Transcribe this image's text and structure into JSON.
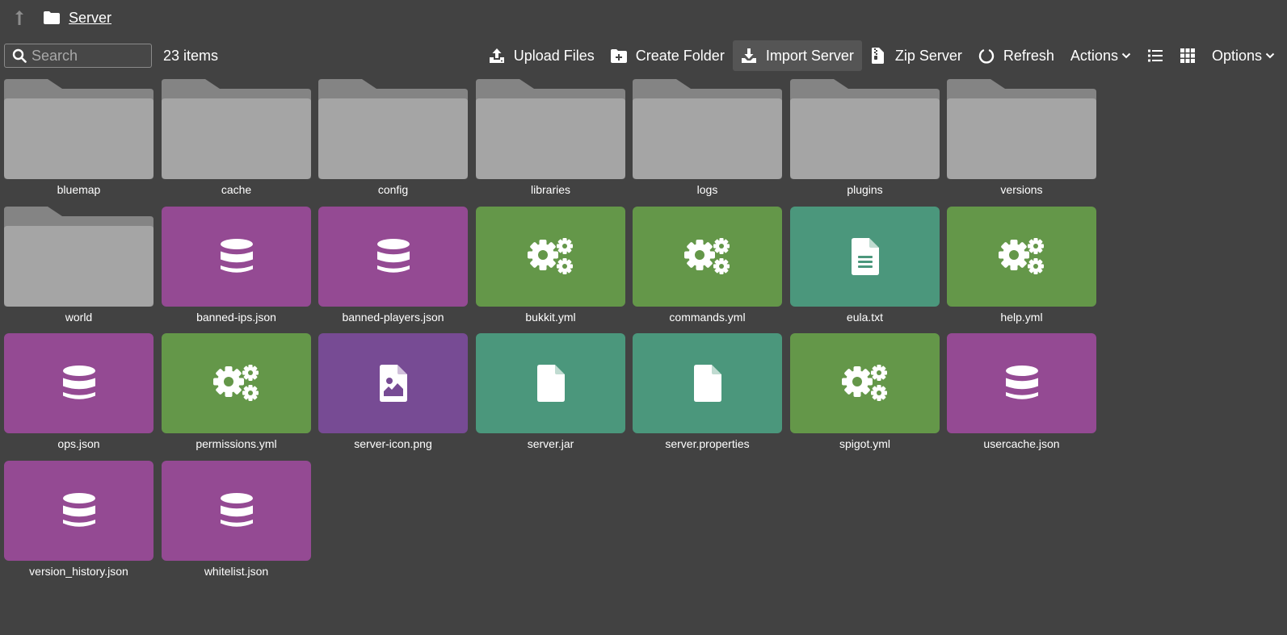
{
  "breadcrumb": {
    "up_icon": "arrow-up-icon",
    "folder_icon": "folder-icon",
    "current": "Server"
  },
  "toolbar": {
    "search_placeholder": "Search",
    "item_count": "23 items",
    "upload_files": "Upload Files",
    "create_folder": "Create Folder",
    "import_server": "Import Server",
    "zip_server": "Zip Server",
    "refresh": "Refresh",
    "actions": "Actions",
    "options": "Options"
  },
  "colors": {
    "background": "#424242",
    "folder": "#a5a5a5",
    "folder_tab": "#848484",
    "json": "#944a93",
    "yml": "#649749",
    "text_file": "#4b977c",
    "image": "#774b94"
  },
  "files": [
    {
      "name": "bluemap",
      "kind": "folder"
    },
    {
      "name": "cache",
      "kind": "folder"
    },
    {
      "name": "config",
      "kind": "folder"
    },
    {
      "name": "libraries",
      "kind": "folder"
    },
    {
      "name": "logs",
      "kind": "folder"
    },
    {
      "name": "plugins",
      "kind": "folder"
    },
    {
      "name": "versions",
      "kind": "folder"
    },
    {
      "name": "world",
      "kind": "folder"
    },
    {
      "name": "banned-ips.json",
      "kind": "database"
    },
    {
      "name": "banned-players.json",
      "kind": "database"
    },
    {
      "name": "bukkit.yml",
      "kind": "gears"
    },
    {
      "name": "commands.yml",
      "kind": "gears"
    },
    {
      "name": "eula.txt",
      "kind": "document"
    },
    {
      "name": "help.yml",
      "kind": "gears"
    },
    {
      "name": "ops.json",
      "kind": "database"
    },
    {
      "name": "permissions.yml",
      "kind": "gears"
    },
    {
      "name": "server-icon.png",
      "kind": "image"
    },
    {
      "name": "server.jar",
      "kind": "file"
    },
    {
      "name": "server.properties",
      "kind": "file"
    },
    {
      "name": "spigot.yml",
      "kind": "gears"
    },
    {
      "name": "usercache.json",
      "kind": "database"
    },
    {
      "name": "version_history.json",
      "kind": "database"
    },
    {
      "name": "whitelist.json",
      "kind": "database"
    }
  ]
}
